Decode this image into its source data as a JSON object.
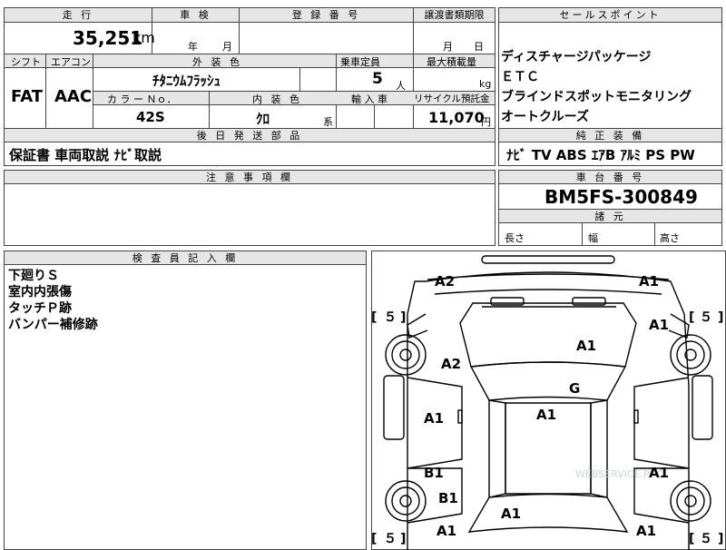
{
  "mileage": {
    "label": "走 行",
    "value": "35,251",
    "unit": "km"
  },
  "inspection": {
    "label": "車 検",
    "year_unit": "年",
    "month_unit": "月"
  },
  "registration": {
    "label": "登 録 番 号"
  },
  "transfer_docs": {
    "label": "譲渡書類期限",
    "month_unit": "月",
    "day_unit": "日"
  },
  "sales_points": {
    "label": "セールスポイント",
    "items": [
      "ディスチャージパッケージ",
      "ＥＴＣ",
      "ブラインドスポットモニタリング",
      "オートクルーズ"
    ]
  },
  "shift": {
    "label": "シフト",
    "value": "FAT"
  },
  "aircon": {
    "label": "エアコン",
    "value": "AAC"
  },
  "exterior_color": {
    "label": "外 装 色",
    "value": "ﾁﾀﾆｳﾑﾌﾗｯｼｭ"
  },
  "capacity": {
    "label": "乗車定員",
    "value": "5",
    "unit": "人"
  },
  "max_load": {
    "label": "最大積載量",
    "unit": "kg"
  },
  "color_no": {
    "label": "カ ラ ー Ｎｏ．",
    "value": "42S"
  },
  "interior_color": {
    "label": "内 装 色",
    "value": "ｸﾛ",
    "suffix": "系"
  },
  "import": {
    "label": "輸 入 車"
  },
  "recycle": {
    "label": "リサイクル預託金",
    "value": "11,070",
    "unit": "円"
  },
  "later_parts": {
    "label": "後 日 発 送 部 品",
    "value": "保証書 車両取説 ﾅﾋﾞ取説"
  },
  "genuine": {
    "label": "純 正 装 備",
    "value": "ﾅﾋﾞ TV ABS ｴｱB ｱﾙﾐ PS PW"
  },
  "notes": {
    "label": "注 意 事 項 欄"
  },
  "chassis": {
    "label": "車 台 番 号",
    "value": "BM5FS-300849"
  },
  "specs": {
    "label": "諸 元",
    "length": "長さ",
    "width": "幅",
    "height": "高さ"
  },
  "inspector": {
    "label": "検 査 員 記 入 欄",
    "lines": [
      "下廻りＳ",
      "室内内張傷",
      "タッチＰ跡",
      "バンパー補修跡"
    ]
  },
  "diagram": {
    "watermark": "WEBSERVICE.PRO",
    "marks": {
      "a2_top_left": "A2",
      "a1_top_right": "A1",
      "a1_right_fender": "A1",
      "a1_hood": "A1",
      "a2_left_fender": "A2",
      "g_windshield": "G",
      "a1_roof": "A1",
      "a1_left_door": "A1",
      "b1_left_rear_door": "B1",
      "b1_left_quarter": "B1",
      "a1_right_door": "A1",
      "a1_rear_left": "A1",
      "a1_rear_center": "A1",
      "a1_rear_right": "A1"
    },
    "tires": {
      "front_left": "５",
      "front_right": "５",
      "rear_left": "５",
      "rear_right": "５"
    }
  }
}
